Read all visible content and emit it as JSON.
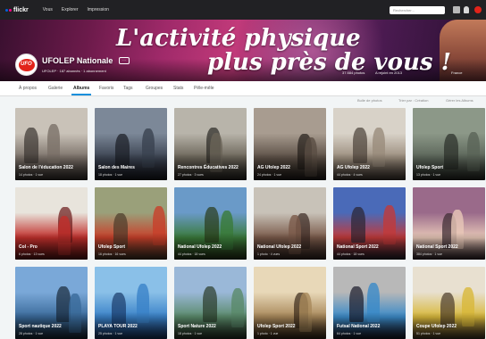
{
  "topnav": {
    "logo": "flickr",
    "links": [
      "Vous",
      "Explorer",
      "Impression"
    ],
    "search_placeholder": "Rechercher...",
    "icons": [
      "upload-icon",
      "bell-icon",
      "user-avatar"
    ]
  },
  "profile": {
    "cover_slogan_1": "L'activité physique",
    "cover_slogan_2": "plus près de vous !",
    "avatar_text": "UFO",
    "name": "UFOLEP Nationale",
    "follow_label": "···",
    "meta": "UFOLEP · 187 abonnés · 1 abonnement",
    "stats": [
      "37 884 photos",
      "A rejoint en 2013",
      "France"
    ]
  },
  "subnav": {
    "tabs": [
      "À propos",
      "Galerie",
      "Albums",
      "Favoris",
      "Tags",
      "Groupes",
      "Stats",
      "Pêle-mêle"
    ],
    "active_index": 2
  },
  "toolbar": {
    "items": [
      "Bulle de photos",
      "Trier par : Création",
      "Gérer les Albums"
    ]
  },
  "albums": [
    {
      "title": "Salon de l'éducation 2022",
      "meta": "14 photos · 1 vue",
      "colors": [
        "#c9c2b8",
        "#7a7068",
        "#3a3430"
      ]
    },
    {
      "title": "Salon des Maires",
      "meta": "18 photos · 1 vue",
      "colors": [
        "#7c8898",
        "#3a4250",
        "#1a1c24"
      ]
    },
    {
      "title": "Rencontres Éducatives 2022",
      "meta": "27 photos · 3 vues",
      "colors": [
        "#b8b4aa",
        "#6a6458",
        "#2a2824"
      ]
    },
    {
      "title": "AG Ufolep 2022",
      "meta": "24 photos · 1 vue",
      "colors": [
        "#a89c90",
        "#5a4e44",
        "#241e1a"
      ]
    },
    {
      "title": "AG Ufolep 2022",
      "meta": "44 photos · 4 vues",
      "colors": [
        "#d8d2c8",
        "#9a8c7c",
        "#4a4038"
      ]
    },
    {
      "title": "Ufolep Sport",
      "meta": "13 photos · 1 vue",
      "colors": [
        "#8c9888",
        "#5a6458",
        "#2a2e28"
      ]
    },
    {
      "title": "Col - Pro",
      "meta": "6 photos · 13 vues",
      "colors": [
        "#e8e4dc",
        "#c2302c",
        "#6a1818"
      ]
    },
    {
      "title": "Ufolep Sport",
      "meta": "16 photos · 16 vues",
      "colors": [
        "#9aa07a",
        "#c8402a",
        "#4a3a2a"
      ]
    },
    {
      "title": "National Ufolep 2022",
      "meta": "44 photos · 18 vues",
      "colors": [
        "#6a9ac8",
        "#3a7a3a",
        "#2a3a1a"
      ]
    },
    {
      "title": "National Ufolep 2022",
      "meta": "1 photo · 4 vues",
      "colors": [
        "#c8c2b8",
        "#7a5a4a",
        "#3a2a24"
      ]
    },
    {
      "title": "National Sport 2022",
      "meta": "44 photos · 18 vues",
      "colors": [
        "#4a6ab8",
        "#c23a3a",
        "#2a2430"
      ]
    },
    {
      "title": "National Sport 2022",
      "meta": "384 photos · 1 vue",
      "colors": [
        "#9a6a8a",
        "#e8c8b8",
        "#3a2a30"
      ]
    },
    {
      "title": "Sport nautique 2022",
      "meta": "28 photos · 1 vue",
      "colors": [
        "#7aa8d8",
        "#3a6a9a",
        "#1a2a3a"
      ]
    },
    {
      "title": "PLAYA TOUR 2022",
      "meta": "25 photos · 1 vue",
      "colors": [
        "#8ac0e8",
        "#3a82c8",
        "#1a3a6a"
      ]
    },
    {
      "title": "Sport Nature 2022",
      "meta": "18 photos · 1 vue",
      "colors": [
        "#9ab8d8",
        "#5a8a6a",
        "#2a3a2a"
      ]
    },
    {
      "title": "Ufolep Sport 2022",
      "meta": "1 photo · 1 vue",
      "colors": [
        "#e8d8b8",
        "#a8885a",
        "#3a2a1a"
      ]
    },
    {
      "title": "Futsal National 2022",
      "meta": "64 photos · 1 vue",
      "colors": [
        "#b8b8b8",
        "#3a8ac8",
        "#1a1a2a"
      ]
    },
    {
      "title": "Coupe Ufolep 2022",
      "meta": "51 photos · 1 vue",
      "colors": [
        "#e8e0d0",
        "#d8b83a",
        "#4a3a2a"
      ]
    }
  ]
}
